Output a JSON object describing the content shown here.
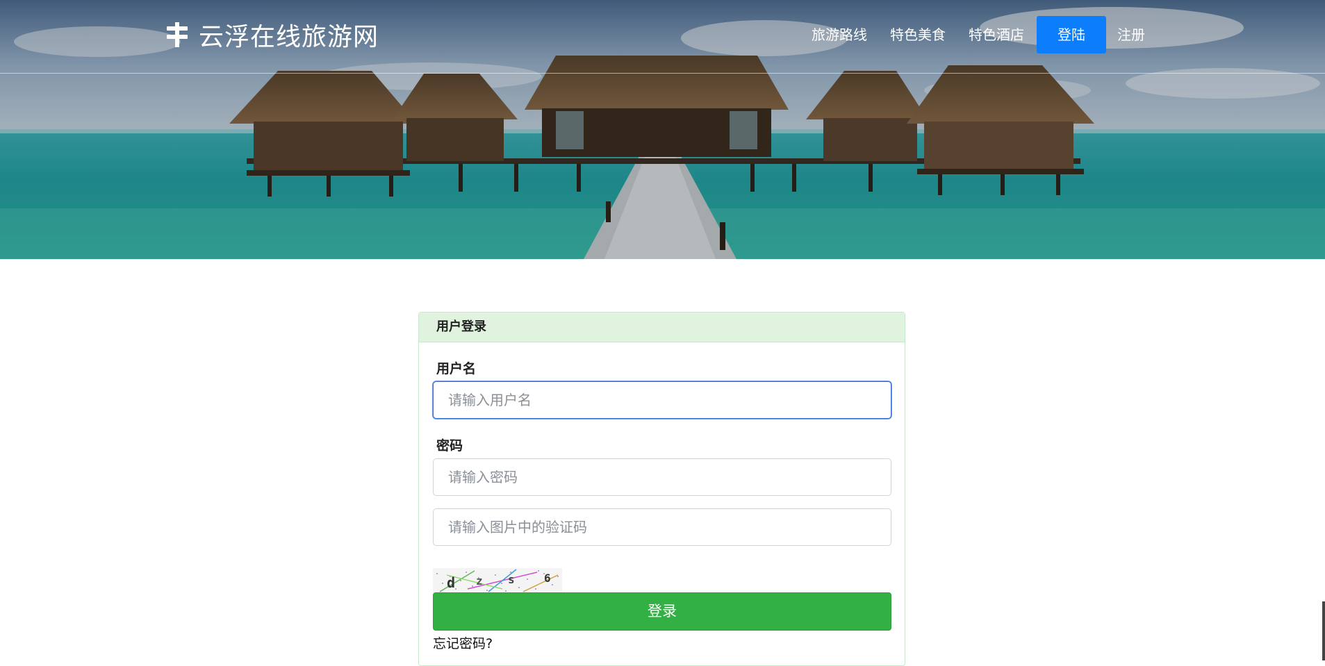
{
  "site": {
    "brand_name": "云浮在线旅游网",
    "brand_icon": "signpost-icon"
  },
  "nav": {
    "items": [
      {
        "label": "旅游路线"
      },
      {
        "label": "特色美食"
      },
      {
        "label": "特色酒店"
      },
      {
        "label": "登陆",
        "active": true
      },
      {
        "label": "注册"
      }
    ]
  },
  "login": {
    "title": "用户登录",
    "username_label": "用户名",
    "username_placeholder": "请输入用户名",
    "password_label": "密码",
    "password_placeholder": "请输入密码",
    "captcha_placeholder": "请输入图片中的验证码",
    "captcha_text": "dzs6",
    "submit_label": "登录",
    "forgot_label": "忘记密码?"
  },
  "colors": {
    "accent": "#0d7efb",
    "success": "#33b043",
    "card_header_bg": "#dff3df"
  }
}
